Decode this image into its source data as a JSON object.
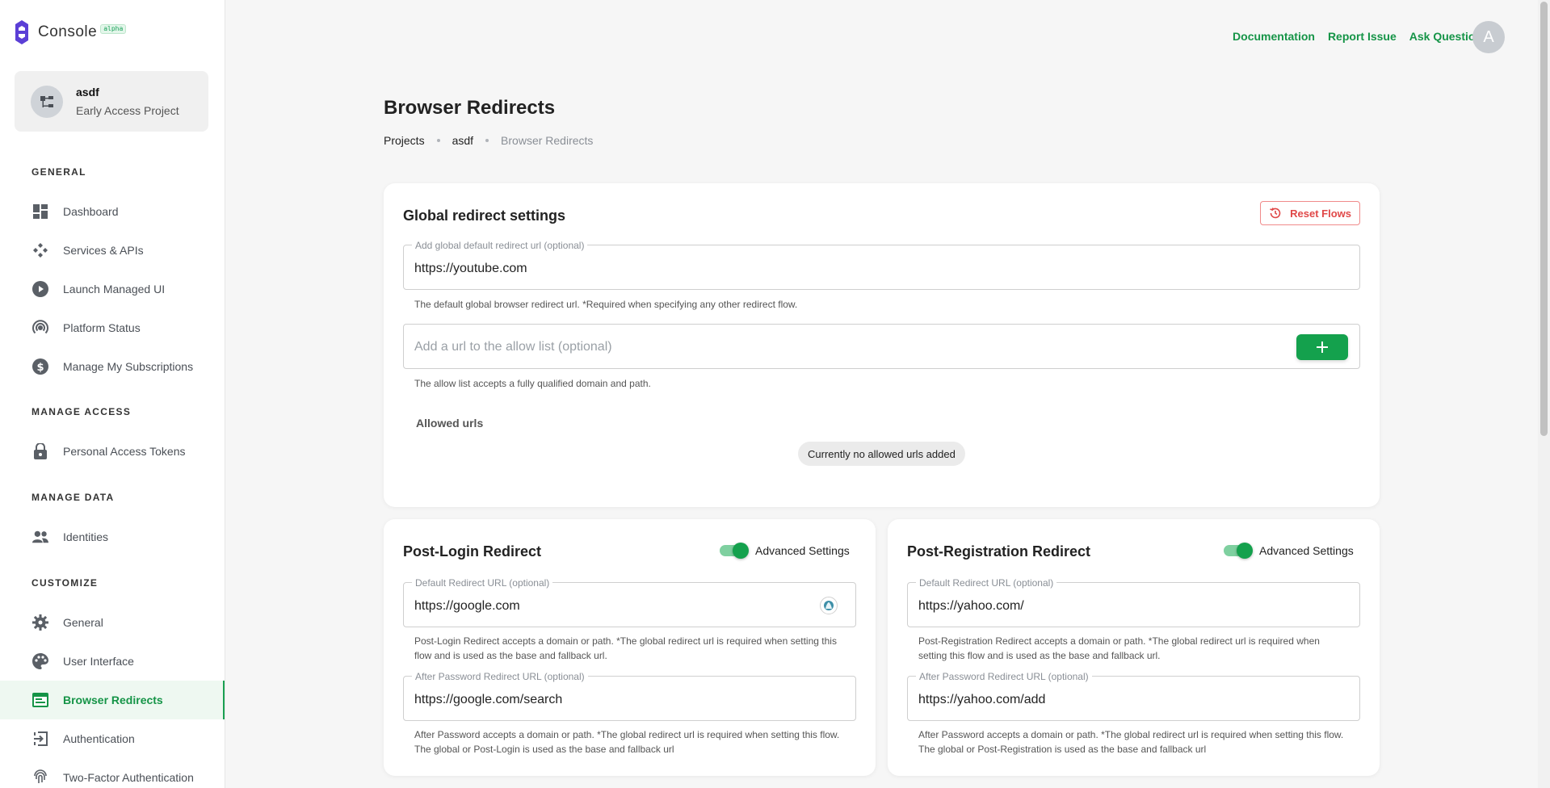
{
  "app": {
    "name": "Console",
    "badge": "alpha"
  },
  "project": {
    "name": "asdf",
    "subtitle": "Early Access Project"
  },
  "sidebar": {
    "sections": [
      {
        "title": "GENERAL"
      },
      {
        "title": "MANAGE ACCESS"
      },
      {
        "title": "MANAGE DATA"
      },
      {
        "title": "CUSTOMIZE"
      }
    ],
    "items": [
      {
        "label": "Dashboard",
        "icon": "dashboard-icon"
      },
      {
        "label": "Services & APIs",
        "icon": "services-icon"
      },
      {
        "label": "Launch Managed UI",
        "icon": "play-icon"
      },
      {
        "label": "Platform Status",
        "icon": "broadcast-icon"
      },
      {
        "label": "Manage My Subscriptions",
        "icon": "dollar-icon"
      },
      {
        "label": "Personal Access Tokens",
        "icon": "lock-icon"
      },
      {
        "label": "Identities",
        "icon": "people-icon"
      },
      {
        "label": "General",
        "icon": "gear-icon"
      },
      {
        "label": "User Interface",
        "icon": "palette-icon"
      },
      {
        "label": "Browser Redirects",
        "icon": "browser-icon",
        "active": true
      },
      {
        "label": "Authentication",
        "icon": "login-icon"
      },
      {
        "label": "Two-Factor Authentication",
        "icon": "fingerprint-icon"
      }
    ]
  },
  "header": {
    "links": [
      "Documentation",
      "Report Issue",
      "Ask Question"
    ],
    "avatar_initial": "A"
  },
  "page": {
    "title": "Browser Redirects",
    "breadcrumb": [
      "Projects",
      "asdf",
      "Browser Redirects"
    ]
  },
  "global": {
    "title": "Global redirect settings",
    "reset_label": "Reset Flows",
    "default_url_label": "Add global default redirect url (optional)",
    "default_url_value": "https://youtube.com",
    "default_url_helper": "The default global browser redirect url. *Required when specifying any other redirect flow.",
    "allow_placeholder": "Add a url to the allow list (optional)",
    "allow_helper": "The allow list accepts a fully qualified domain and path.",
    "allowed_title": "Allowed urls",
    "empty_chip": "Currently no allowed urls added"
  },
  "post_login": {
    "title": "Post-Login Redirect",
    "toggle_label": "Advanced Settings",
    "toggle_on": true,
    "default_label": "Default Redirect URL (optional)",
    "default_value": "https://google.com",
    "default_helper_1": "Post-Login Redirect accepts a domain or path. *The global redirect url is required when setting this",
    "default_helper_2": "flow and is used as the base and fallback url.",
    "after_label": "After Password Redirect URL (optional)",
    "after_value": "https://google.com/search",
    "after_helper_1": "After Password accepts a domain or path. *The global redirect url is required when setting this flow.",
    "after_helper_2": "The global or Post-Login is used as the base and fallback url"
  },
  "post_registration": {
    "title": "Post-Registration Redirect",
    "toggle_label": "Advanced Settings",
    "toggle_on": true,
    "default_label": "Default Redirect URL (optional)",
    "default_value": "https://yahoo.com/",
    "default_helper_1": "Post-Registration Redirect accepts a domain or path. *The global redirect url is required when",
    "default_helper_2": "setting this flow and is used as the base and fallback url.",
    "after_label": "After Password Redirect URL (optional)",
    "after_value": "https://yahoo.com/add",
    "after_helper_1": "After Password accepts a domain or path. *The global redirect url is required when setting this flow.",
    "after_helper_2": "The global or Post-Registration is used as the base and fallback url"
  },
  "colors": {
    "accent": "#14a14d",
    "danger": "#e04848",
    "logo": "#5b3fd6"
  }
}
